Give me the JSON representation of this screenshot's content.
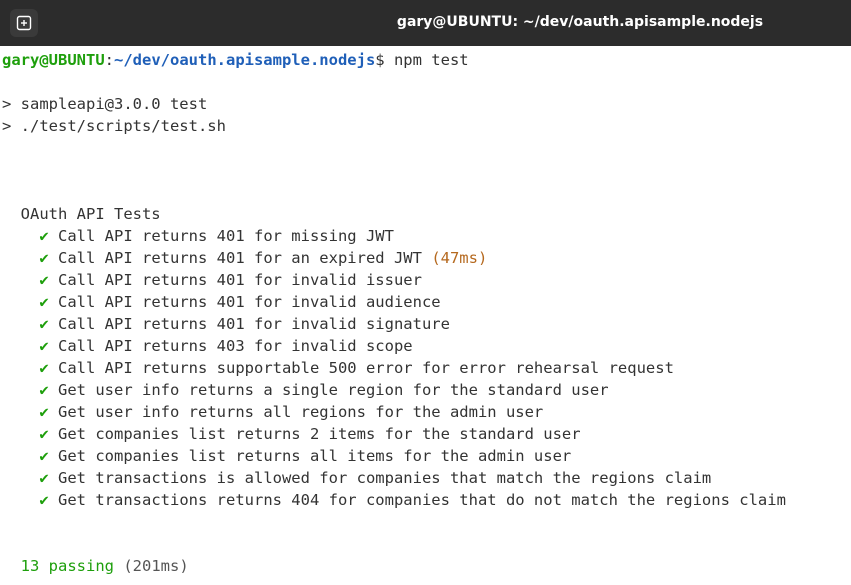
{
  "window": {
    "title": "gary@UBUNTU: ~/dev/oauth.apisample.nodejs"
  },
  "prompt": {
    "user": "gary@UBUNTU",
    "sep": ":",
    "path": "~/dev/oauth.apisample.nodejs",
    "symbol": "$",
    "command": " npm test"
  },
  "npm_output": [
    "> sampleapi@3.0.0 test",
    "> ./test/scripts/test.sh"
  ],
  "suite": {
    "title": "  OAuth API Tests",
    "check_glyph": "✔",
    "tests": [
      {
        "name": "Call API returns 401 for missing JWT",
        "duration": ""
      },
      {
        "name": "Call API returns 401 for an expired JWT",
        "duration": "(47ms)"
      },
      {
        "name": "Call API returns 401 for invalid issuer",
        "duration": ""
      },
      {
        "name": "Call API returns 401 for invalid audience",
        "duration": ""
      },
      {
        "name": "Call API returns 401 for invalid signature",
        "duration": ""
      },
      {
        "name": "Call API returns 403 for invalid scope",
        "duration": ""
      },
      {
        "name": "Call API returns supportable 500 error for error rehearsal request",
        "duration": ""
      },
      {
        "name": "Get user info returns a single region for the standard user",
        "duration": ""
      },
      {
        "name": "Get user info returns all regions for the admin user",
        "duration": ""
      },
      {
        "name": "Get companies list returns 2 items for the standard user",
        "duration": ""
      },
      {
        "name": "Get companies list returns all items for the admin user",
        "duration": ""
      },
      {
        "name": "Get transactions is allowed for companies that match the regions claim",
        "duration": ""
      },
      {
        "name": "Get transactions returns 404 for companies that do not match the regions claim",
        "duration": ""
      }
    ]
  },
  "summary": {
    "passing": "  13 passing",
    "duration": "(201ms)"
  },
  "colors": {
    "titlebar": "#2c2c2c",
    "user": "#1e9f0c",
    "path": "#1f5fb8",
    "check": "#1e9f0c",
    "duration": "#b5691f",
    "text": "#333333"
  },
  "icons": {
    "new_tab": "new-tab-icon"
  }
}
